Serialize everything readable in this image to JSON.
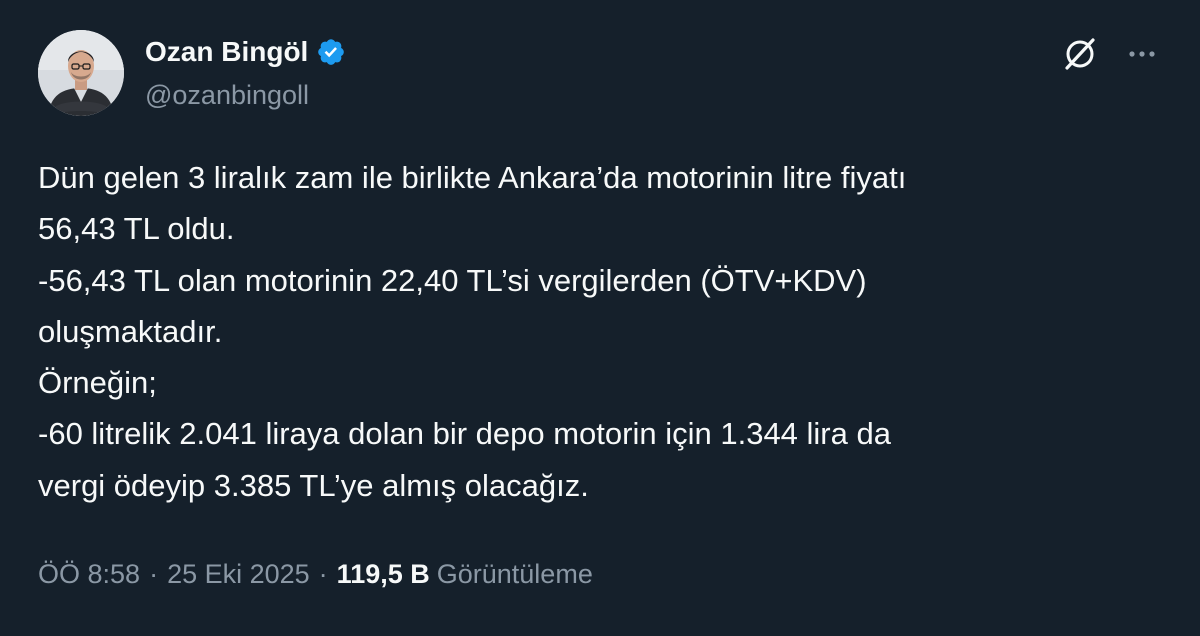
{
  "author": {
    "display_name": "Ozan Bingöl",
    "handle": "@ozanbingoll",
    "verified": true
  },
  "tweet": {
    "lines": [
      "Dün gelen 3 liralık zam ile birlikte Ankara’da motorinin litre fiyatı",
      "56,43 TL oldu.",
      "-56,43 TL olan motorinin 22,40 TL’si vergilerden (ÖTV+KDV)",
      "oluşmaktadır.",
      "Örneğin;",
      "-60 litrelik 2.041 liraya dolan bir depo motorin için 1.344 lira da",
      "vergi ödeyip 3.385 TL’ye almış olacağız."
    ]
  },
  "meta": {
    "time": "ÖÖ 8:58",
    "separator": "·",
    "date": "25 Eki 2025",
    "views_count": "119,5 B",
    "views_label": "Görüntüleme"
  },
  "icons": {
    "verified": "verified-badge-icon",
    "grok": "grok-icon",
    "more": "more-options-icon"
  },
  "colors": {
    "background": "#15202b",
    "primary_text": "#f7f9f9",
    "secondary_text": "#8b98a5",
    "verified_blue": "#1d9bf0"
  }
}
